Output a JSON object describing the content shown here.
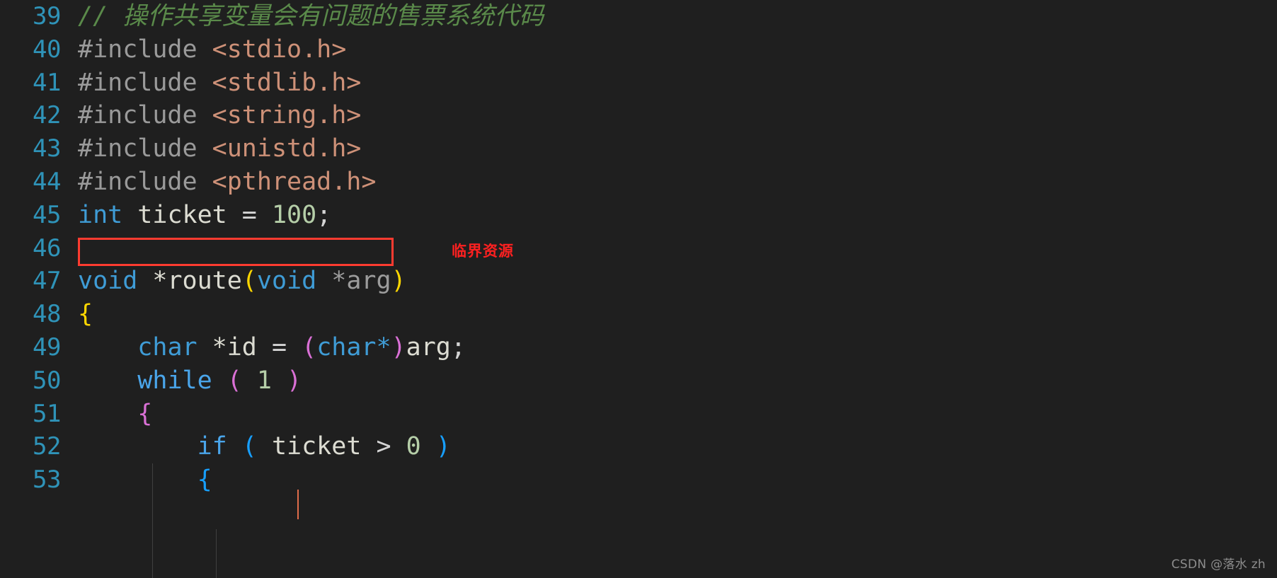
{
  "editor": {
    "background": "#1f1f1f",
    "line_number_color": "#2f93b8",
    "first_visible_line": 39,
    "last_visible_line": 53
  },
  "lines": [
    {
      "n": "39",
      "text": "// 操作共享变量会有问题的售票系统代码"
    },
    {
      "n": "40",
      "text": "#include <stdio.h>"
    },
    {
      "n": "41",
      "text": "#include <stdlib.h>"
    },
    {
      "n": "42",
      "text": "#include <string.h>"
    },
    {
      "n": "43",
      "text": "#include <unistd.h>"
    },
    {
      "n": "44",
      "text": "#include <pthread.h>"
    },
    {
      "n": "45",
      "text": "int ticket = 100;"
    },
    {
      "n": "46",
      "text": ""
    },
    {
      "n": "47",
      "text": "void *route(void *arg)"
    },
    {
      "n": "48",
      "text": "{"
    },
    {
      "n": "49",
      "text": "    char *id = (char*)arg;"
    },
    {
      "n": "50",
      "text": "    while ( 1 )"
    },
    {
      "n": "51",
      "text": "    {"
    },
    {
      "n": "52",
      "text": "        if ( ticket > 0 )"
    },
    {
      "n": "53",
      "text": "        {"
    }
  ],
  "tokens": {
    "l39": {
      "slashes": "//",
      "comment": " 操作共享变量会有问题的售票系统代码"
    },
    "l40": {
      "directive": "#include ",
      "header": "<stdio.h>"
    },
    "l41": {
      "directive": "#include ",
      "header": "<stdlib.h>"
    },
    "l42": {
      "directive": "#include ",
      "header": "<string.h>"
    },
    "l43": {
      "directive": "#include ",
      "header": "<unistd.h>"
    },
    "l44": {
      "directive": "#include ",
      "header": "<pthread.h>"
    },
    "l45": {
      "type": "int",
      "sp1": " ",
      "name": "ticket",
      "eq": " = ",
      "num": "100",
      "semi": ";"
    },
    "l47": {
      "type": "void",
      "star_name": " *route",
      "paren_open": "(",
      "ptype": "void",
      "param": " *arg",
      "paren_close": ")"
    },
    "l48": {
      "brace": "{"
    },
    "l49": {
      "indent": "    ",
      "type": "char",
      "star_name": " *id",
      "eq": " = ",
      "paren_open": "(",
      "cast": "char*",
      "paren_close": ")",
      "arg": "arg",
      "semi": ";"
    },
    "l50": {
      "indent": "    ",
      "kw": "while",
      "sp": " ",
      "paren_open": "(",
      "inner": " 1 ",
      "paren_close": ")"
    },
    "l51": {
      "indent": "    ",
      "brace": "{"
    },
    "l52": {
      "indent": "        ",
      "kw": "if",
      "sp": " ",
      "paren_open": "(",
      "cond_var": " ticket ",
      "op": ">",
      "num": " 0 ",
      "paren_close": ")"
    },
    "l53": {
      "indent": "        ",
      "brace": "{"
    }
  },
  "annotation": {
    "label": "临界资源",
    "color": "#ff2020",
    "box_color": "#ff3b30",
    "target_line": "45"
  },
  "watermark": {
    "text": "CSDN @落水 zh"
  }
}
